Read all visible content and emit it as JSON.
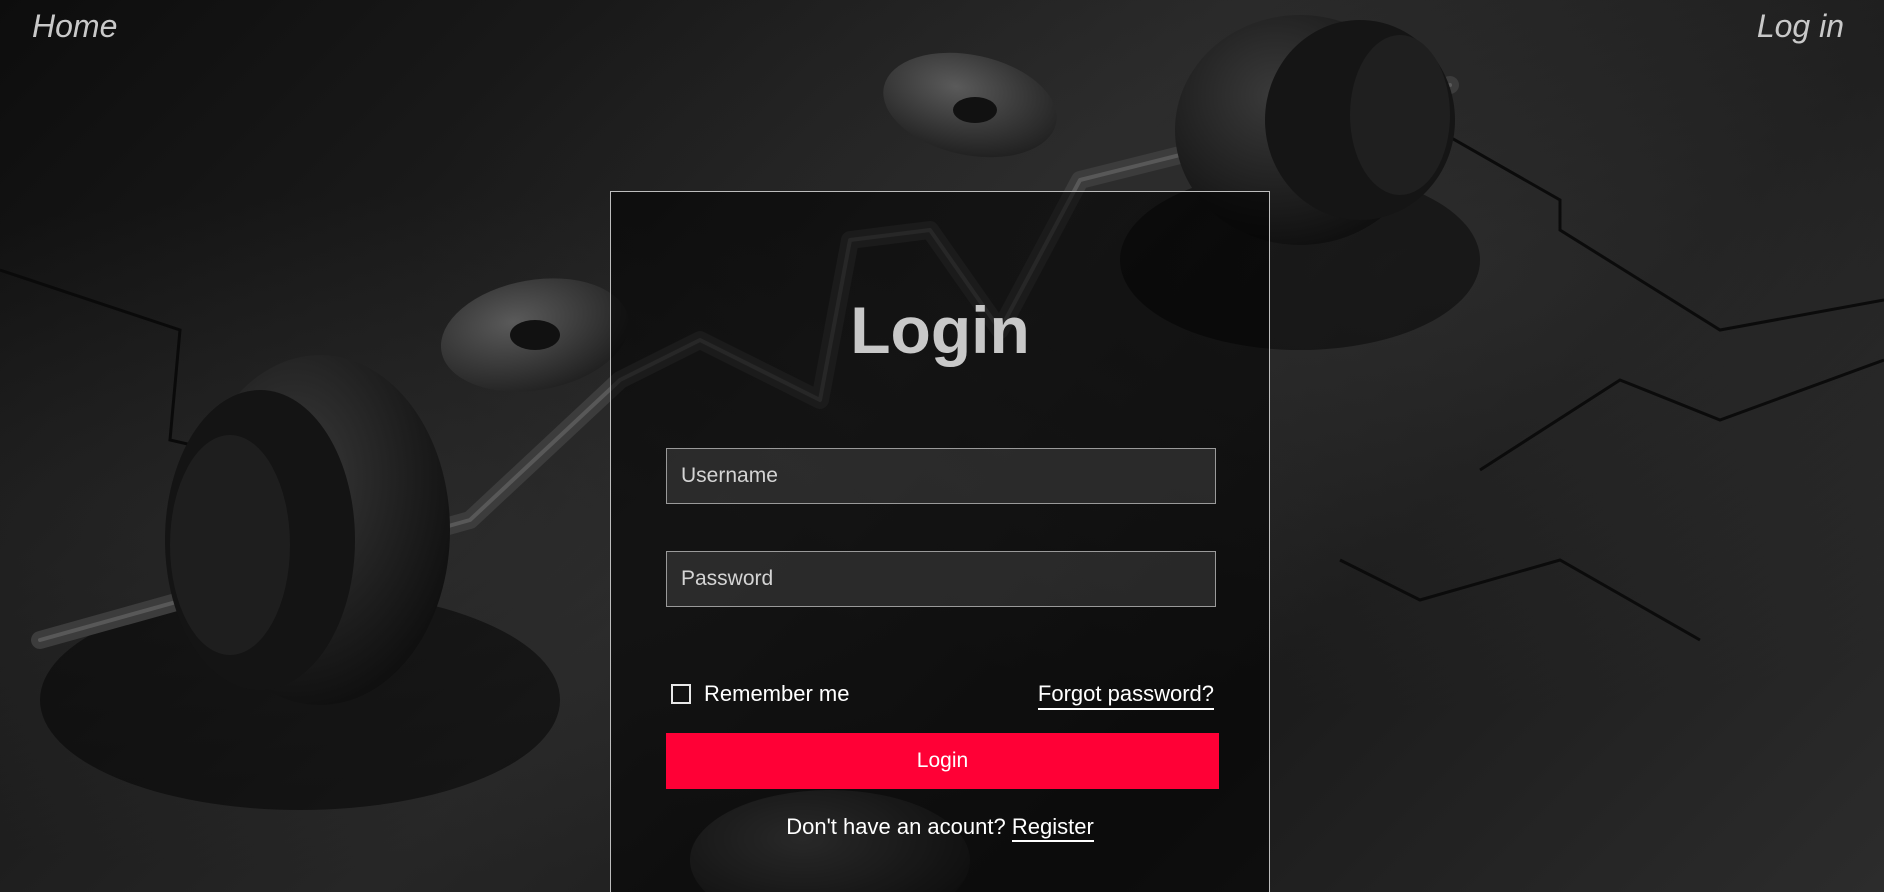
{
  "nav": {
    "home_label": "Home",
    "login_label": "Log in"
  },
  "login_form": {
    "title": "Login",
    "username_placeholder": "Username",
    "username_value": "",
    "password_placeholder": "Password",
    "password_value": "",
    "remember_label": "Remember me",
    "remember_checked": false,
    "forgot_label": "Forgot password?",
    "submit_label": "Login",
    "register_prompt": "Don't have an acount?",
    "register_label": "Register"
  },
  "colors": {
    "accent": "#ff0036",
    "card_border": "#bdbdbd",
    "title_text": "#c8c8c8"
  },
  "background": {
    "image": "barbell-with-weight-plates-on-gym-floor-icon"
  }
}
